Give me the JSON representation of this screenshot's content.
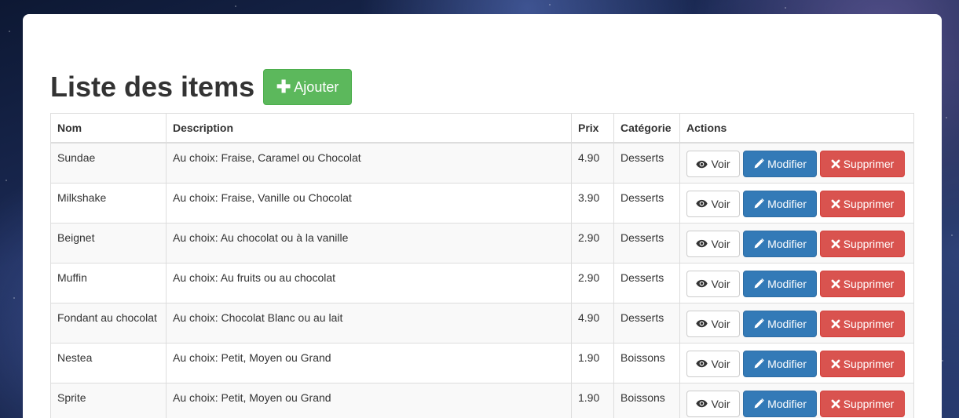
{
  "page": {
    "title": "Liste des items",
    "add_label": "Ajouter"
  },
  "table": {
    "headers": [
      "Nom",
      "Description",
      "Prix",
      "Catégorie",
      "Actions"
    ],
    "rows": [
      {
        "name": "Sundae",
        "description": "Au choix: Fraise, Caramel ou Chocolat",
        "price": "4.90",
        "category": "Desserts"
      },
      {
        "name": "Milkshake",
        "description": "Au choix: Fraise, Vanille ou Chocolat",
        "price": "3.90",
        "category": "Desserts"
      },
      {
        "name": "Beignet",
        "description": "Au choix: Au chocolat ou à la vanille",
        "price": "2.90",
        "category": "Desserts"
      },
      {
        "name": "Muffin",
        "description": "Au choix: Au fruits ou au chocolat",
        "price": "2.90",
        "category": "Desserts"
      },
      {
        "name": "Fondant au chocolat",
        "description": "Au choix: Chocolat Blanc ou au lait",
        "price": "4.90",
        "category": "Desserts"
      },
      {
        "name": "Nestea",
        "description": "Au choix: Petit, Moyen ou Grand",
        "price": "1.90",
        "category": "Boissons"
      },
      {
        "name": "Sprite",
        "description": "Au choix: Petit, Moyen ou Grand",
        "price": "1.90",
        "category": "Boissons"
      }
    ]
  },
  "actions": {
    "view_label": "Voir",
    "edit_label": "Modifier",
    "delete_label": "Supprimer"
  },
  "icons": {
    "add": "plus-icon",
    "view": "eye-icon",
    "edit": "pencil-icon",
    "delete": "cross-icon"
  },
  "colors": {
    "success": "#5cb85c",
    "primary": "#337ab7",
    "danger": "#d9534f"
  }
}
